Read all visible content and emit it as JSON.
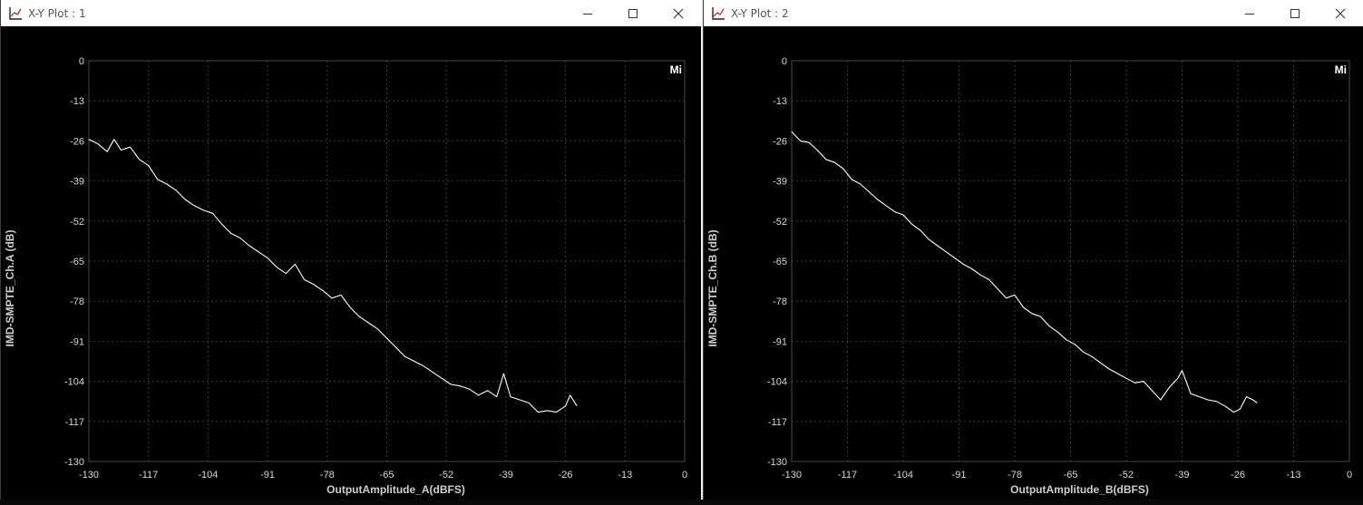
{
  "colors": {
    "background": "#000000",
    "grid": "#3c3c3c",
    "trace": "#ffffff",
    "tick_text": "#d8d8d8",
    "titlebar": "#ffffff"
  },
  "window_controls": [
    "minimize-icon",
    "maximize-icon",
    "close-icon"
  ],
  "windows": [
    {
      "title": "X-Y Plot : 1",
      "legend_button": "Mi",
      "xlabel": "OutputAmplitude_A(dBFS)",
      "ylabel": "IMD-SMPTE_Ch.A (dB)",
      "x_ticks": [
        "-130",
        "-117",
        "-104",
        "-91",
        "-78",
        "-65",
        "-52",
        "-39",
        "-26",
        "-13",
        "0"
      ],
      "y_ticks": [
        "0",
        "-13",
        "-26",
        "-39",
        "-52",
        "-65",
        "-78",
        "-91",
        "-104",
        "-117",
        "-130"
      ]
    },
    {
      "title": "X-Y Plot : 2",
      "legend_button": "Mi",
      "xlabel": "OutputAmplitude_B(dBFS)",
      "ylabel": "IMD-SMPTE_Ch.B (dB)",
      "x_ticks": [
        "-130",
        "-117",
        "-104",
        "-91",
        "-78",
        "-65",
        "-52",
        "-39",
        "-26",
        "-13",
        "0"
      ],
      "y_ticks": [
        "0",
        "-13",
        "-26",
        "-39",
        "-52",
        "-65",
        "-78",
        "-91",
        "-104",
        "-117",
        "-130"
      ]
    }
  ],
  "chart_data": [
    {
      "type": "line",
      "xlabel": "OutputAmplitude_A(dBFS)",
      "ylabel": "IMD-SMPTE_Ch.A (dB)",
      "xlim": [
        -130,
        0
      ],
      "ylim": [
        -130,
        0
      ],
      "grid": true,
      "series": [
        {
          "x": [
            -130,
            -128,
            -126,
            -124.5,
            -123,
            -121,
            -119,
            -117,
            -115,
            -113,
            -111,
            -109,
            -107,
            -105,
            -103,
            -101,
            -99,
            -97,
            -95,
            -93,
            -91,
            -89,
            -87,
            -85,
            -83,
            -81,
            -79,
            -77,
            -75,
            -73,
            -71,
            -69,
            -67,
            -65,
            -63,
            -61,
            -59,
            -57,
            -55,
            -53,
            -51,
            -49,
            -47,
            -45,
            -43,
            -41,
            -39.5,
            -38,
            -36,
            -34,
            -32,
            -30,
            -28,
            -26,
            -25,
            -23.5
          ],
          "y": [
            -25.5,
            -27,
            -29.5,
            -25.5,
            -29,
            -28,
            -32,
            -34,
            -38.5,
            -40,
            -42,
            -45,
            -47,
            -48.5,
            -49.5,
            -53,
            -56,
            -57.5,
            -60,
            -62,
            -64,
            -67,
            -69,
            -66,
            -71,
            -72.5,
            -74.5,
            -77,
            -76,
            -80,
            -83,
            -85,
            -87,
            -90,
            -93,
            -96,
            -97.5,
            -99,
            -101,
            -103,
            -105,
            -105.5,
            -106.5,
            -108.5,
            -107,
            -109,
            -101.5,
            -109,
            -110,
            -111,
            -114,
            -113.5,
            -114,
            -112,
            -108.5,
            -112
          ]
        }
      ]
    },
    {
      "type": "line",
      "xlabel": "OutputAmplitude_B(dBFS)",
      "ylabel": "IMD-SMPTE_Ch.B (dB)",
      "xlim": [
        -130,
        0
      ],
      "ylim": [
        -130,
        0
      ],
      "grid": true,
      "series": [
        {
          "x": [
            -130,
            -128,
            -126,
            -124,
            -122,
            -120,
            -118,
            -116,
            -114,
            -112,
            -110,
            -108,
            -106,
            -104,
            -102,
            -100,
            -98,
            -96,
            -94,
            -92,
            -90,
            -88,
            -86,
            -84,
            -82,
            -80,
            -78,
            -76,
            -74,
            -72,
            -70,
            -68,
            -66,
            -64,
            -62,
            -60,
            -58,
            -56,
            -54,
            -52,
            -50,
            -48,
            -46,
            -44,
            -42,
            -40,
            -39,
            -37,
            -35,
            -33,
            -31,
            -29,
            -27,
            -25.5,
            -24,
            -22.5,
            -21.5
          ],
          "y": [
            -23,
            -26,
            -26.5,
            -29,
            -32,
            -33,
            -35,
            -38.5,
            -40,
            -42.5,
            -45,
            -47,
            -49,
            -50,
            -53,
            -55,
            -58,
            -60,
            -62,
            -64,
            -66,
            -67.5,
            -69.5,
            -71,
            -74,
            -77,
            -76,
            -80,
            -82,
            -83,
            -86,
            -88,
            -90.5,
            -92,
            -94.5,
            -96,
            -98,
            -100,
            -101.5,
            -103,
            -104.5,
            -104,
            -107,
            -110,
            -106,
            -103,
            -100.5,
            -108,
            -109,
            -110,
            -110.5,
            -112,
            -114,
            -113,
            -109,
            -110,
            -111
          ]
        }
      ]
    }
  ]
}
